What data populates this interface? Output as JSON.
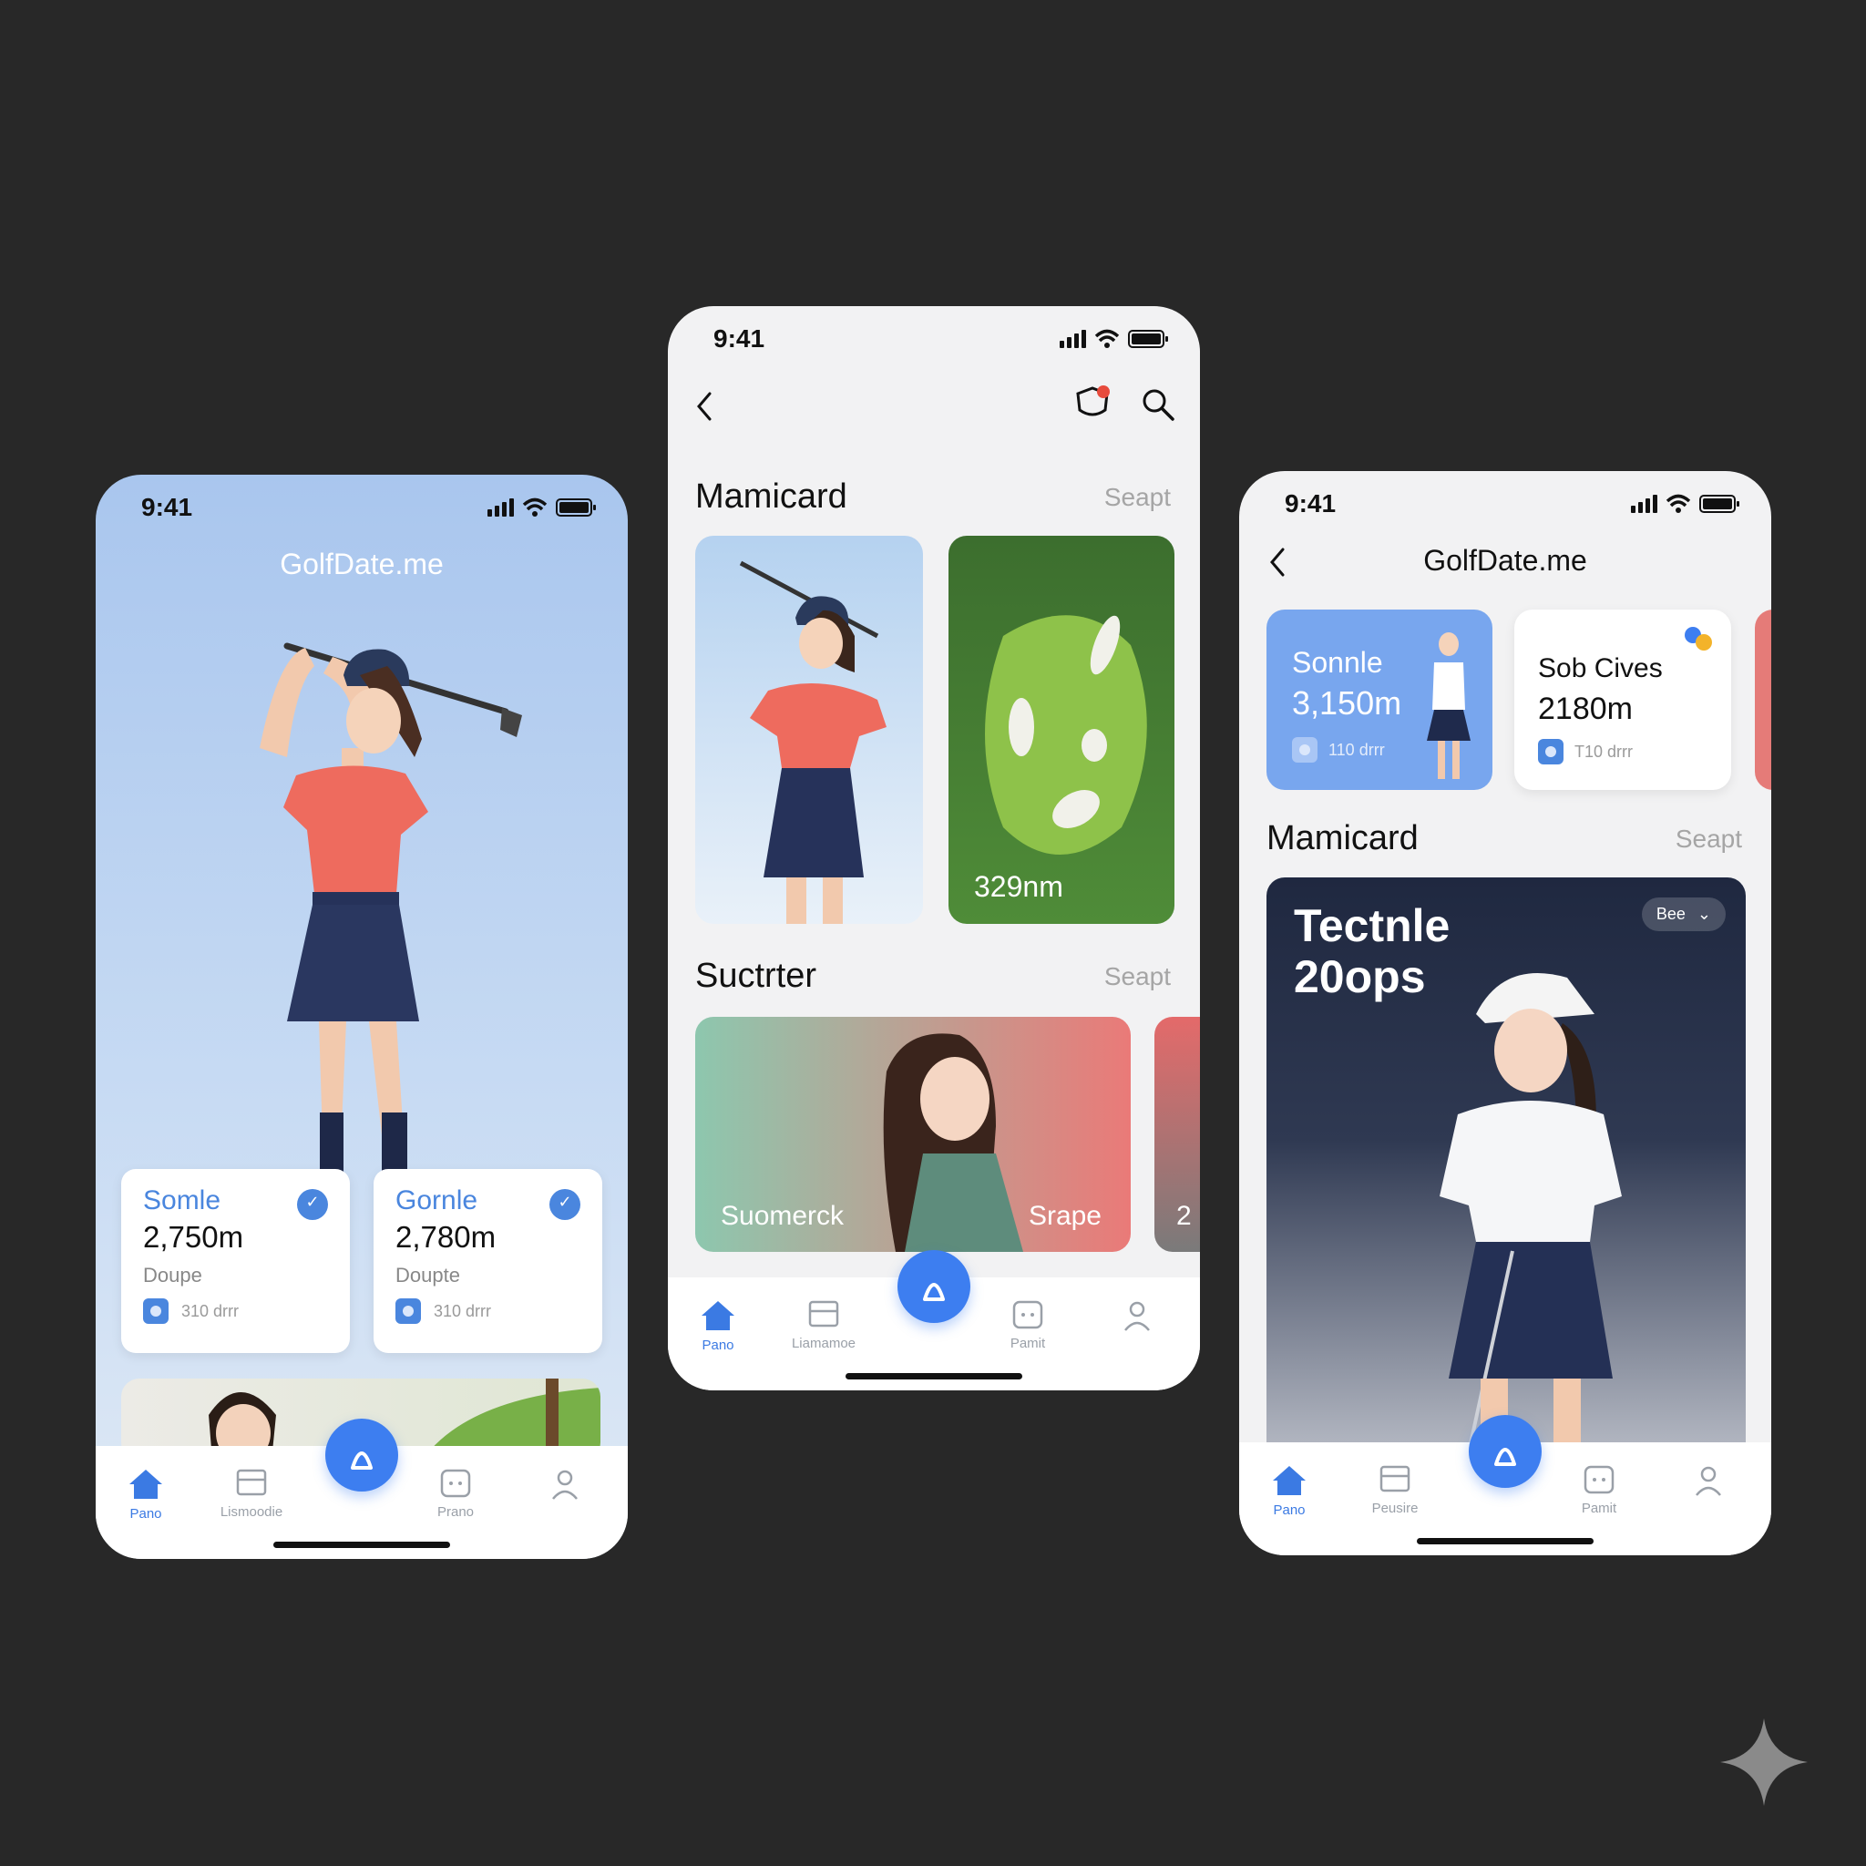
{
  "phone1": {
    "time": "9:41",
    "brand": "GolfDate.me",
    "cards": [
      {
        "title": "Somle",
        "value": "2,750m",
        "sub": "Doupe",
        "foot": "310 drrr"
      },
      {
        "title": "Gornle",
        "value": "2,780m",
        "sub": "Doupte",
        "foot": "310 drrr"
      }
    ],
    "tabs": [
      "Pano",
      "Lismoodie",
      "Prano"
    ]
  },
  "phone2": {
    "time": "9:41",
    "section1": {
      "title": "Mamicard",
      "link": "Seapt"
    },
    "course_distance": "329nm",
    "section2": {
      "title": "Suctrter",
      "link": "Seapt"
    },
    "wide_card": {
      "left": "Suomerck",
      "right": "Srape"
    },
    "peek_text": "2",
    "tabs": [
      "Pano",
      "Liamamoe",
      "Pamit"
    ]
  },
  "phone3": {
    "time": "9:41",
    "brand": "GolfDate.me",
    "card_a": {
      "title": "Sonnle",
      "value": "3,150m",
      "foot": "110 drrr"
    },
    "card_b": {
      "title": "Sob Cives",
      "value": "2180m",
      "foot": "T10 drrr"
    },
    "section": {
      "title": "Mamicard",
      "link": "Seapt"
    },
    "feature": {
      "line1": "Tectnle",
      "line2": "20ops",
      "chip": "Bee"
    },
    "tabs": [
      "Pano",
      "Peusire",
      "Pamit"
    ]
  },
  "colors": {
    "accent": "#3d7ef0",
    "background": "#282828"
  }
}
